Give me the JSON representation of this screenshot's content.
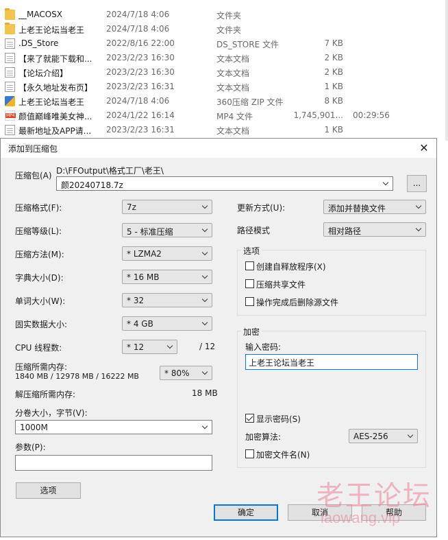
{
  "files": [
    {
      "name": "__MACOSX",
      "date": "2024/7/18 4:06",
      "type": "文件夹",
      "size": "",
      "duration": "",
      "icon": "folder-icon"
    },
    {
      "name": "上老王论坛当老王",
      "date": "2024/7/18 4:06",
      "type": "文件夹",
      "size": "",
      "duration": "",
      "icon": "folder-icon"
    },
    {
      "name": ".DS_Store",
      "date": "2022/8/16 22:00",
      "type": "DS_STORE 文件",
      "size": "7 KB",
      "duration": "",
      "icon": "document-icon"
    },
    {
      "name": "【来了就能下载和...",
      "date": "2023/2/23 16:30",
      "type": "文本文档",
      "size": "2 KB",
      "duration": "",
      "icon": "text-file-icon"
    },
    {
      "name": "【论坛介绍】",
      "date": "2023/2/23 16:30",
      "type": "文本文档",
      "size": "2 KB",
      "duration": "",
      "icon": "text-file-icon"
    },
    {
      "name": "【永久地址发布页】",
      "date": "2023/2/23 16:31",
      "type": "文本文档",
      "size": "1 KB",
      "duration": "",
      "icon": "text-file-icon"
    },
    {
      "name": "上老王论坛当老王",
      "date": "2024/7/18 4:06",
      "type": "360压缩 ZIP 文件",
      "size": "8 KB",
      "duration": "",
      "icon": "zip-archive-icon"
    },
    {
      "name": "颜值巅峰唯美女神...",
      "date": "2024/1/22 16:14",
      "type": "MP4 文件",
      "size": "1,745,901...",
      "duration": "00:29:56",
      "icon": "video-file-icon"
    },
    {
      "name": "最新地址及APP请...",
      "date": "2023/2/23 16:31",
      "type": "文本文档",
      "size": "1 KB",
      "duration": "",
      "icon": "text-file-icon"
    }
  ],
  "dialog": {
    "title": "添加到压缩包",
    "close_glyph": "✕",
    "archive": {
      "label": "压缩包(A)",
      "path": "D:\\FFOutput\\格式工厂\\老王\\",
      "name": "颜20240718.7z",
      "browse_label": "..."
    },
    "left": {
      "format": {
        "label": "压缩格式(F):",
        "value": "7z"
      },
      "level": {
        "label": "压缩等级(L):",
        "value": "5 - 标准压缩"
      },
      "method": {
        "label": "压缩方法(M):",
        "value": "* LZMA2"
      },
      "dict": {
        "label": "字典大小(D):",
        "value": "* 16 MB"
      },
      "word": {
        "label": "单词大小(W):",
        "value": "* 32"
      },
      "solid": {
        "label": "固实数据大小:",
        "value": "* 4 GB"
      },
      "threads": {
        "label": "CPU 线程数:",
        "value": "* 12",
        "max": "/ 12"
      },
      "mem_compress": {
        "label": "压缩所需内存:",
        "detail": "1840 MB / 12978 MB / 16222 MB",
        "value": "* 80%"
      },
      "mem_decompress": {
        "label": "解压缩所需内存:",
        "value": "18 MB"
      },
      "volume": {
        "label": "分卷大小，字节(V):",
        "value": "1000M"
      },
      "params": {
        "label": "参数(P):",
        "value": ""
      },
      "options_button": "选项"
    },
    "right": {
      "update": {
        "label": "更新方式(U):",
        "value": "添加并替换文件"
      },
      "pathmode": {
        "label": "路径模式",
        "value": "相对路径"
      },
      "options_group": {
        "title": "选项",
        "sfx": {
          "label": "创建自释放程序(X)",
          "checked": false
        },
        "shared": {
          "label": "压缩共享文件",
          "checked": false
        },
        "delete": {
          "label": "操作完成后删除源文件",
          "checked": false
        }
      },
      "encryption_group": {
        "title": "加密",
        "password_label": "输入密码:",
        "password": "上老王论坛当老王",
        "show_password": {
          "label": "显示密码(S)",
          "checked": true
        },
        "method_label": "加密算法:",
        "method_value": "AES-256",
        "encrypt_names": {
          "label": "加密文件名(N)",
          "checked": false
        }
      }
    },
    "buttons": {
      "ok": "确定",
      "cancel": "取消",
      "help": "帮助"
    }
  },
  "watermark": {
    "chinese": "老王论坛",
    "latin": "laowang.vip"
  }
}
